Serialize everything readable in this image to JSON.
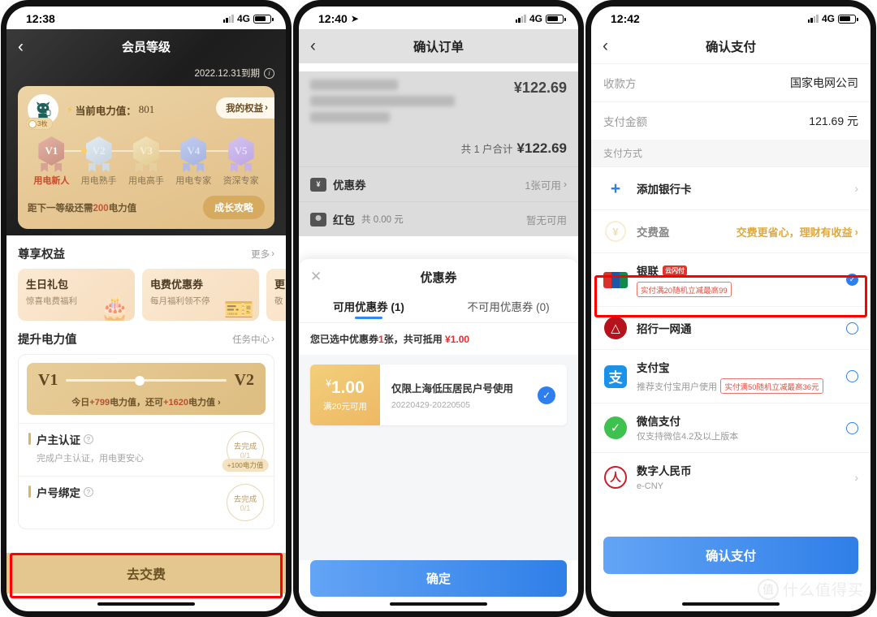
{
  "phone1": {
    "status": {
      "time": "12:38",
      "network": "4G"
    },
    "nav": {
      "title": "会员等级",
      "back_icon": "chevron-left-icon"
    },
    "expiry": "2022.12.31到期",
    "card": {
      "coin_badge": "3枚",
      "power_label": "当前电力值：",
      "power_value": "801",
      "rights_button": "我的权益",
      "levels": [
        {
          "code": "V1",
          "name": "用电新人"
        },
        {
          "code": "V2",
          "name": "用电熟手"
        },
        {
          "code": "V3",
          "name": "用电高手"
        },
        {
          "code": "V4",
          "name": "用电专家"
        },
        {
          "code": "V5",
          "name": "资深专家"
        }
      ],
      "need_prefix": "距下一等级还需",
      "need_value": "200",
      "need_suffix": "电力值",
      "grow_button": "成长攻略"
    },
    "benefits_section": {
      "title": "尊享权益",
      "more": "更多",
      "cards": [
        {
          "title": "生日礼包",
          "desc": "惊喜电费福利",
          "icon": "cake-icon"
        },
        {
          "title": "电费优惠券",
          "desc": "每月福利领不停",
          "icon": "ticket-icon"
        },
        {
          "title": "更",
          "desc": "敬",
          "icon": "more-icon"
        }
      ]
    },
    "boost_section": {
      "title": "提升电力值",
      "more": "任务中心",
      "slider": {
        "from": "V1",
        "to": "V2",
        "today_prefix": "今日",
        "today_value": "+799",
        "today_mid": "电力值，还可",
        "more_value": "+1620",
        "more_suffix": "电力值"
      },
      "tasks": [
        {
          "title": "户主认证",
          "desc": "完成户主认证，用电更安心",
          "action": "去完成",
          "progress": "0/1",
          "reward": "+100电力值"
        },
        {
          "title": "户号绑定",
          "desc": "",
          "action": "去完成",
          "progress": "0/1",
          "reward": ""
        }
      ]
    },
    "bottom_button": "去交费"
  },
  "phone2": {
    "status": {
      "time": "12:40",
      "network": "4G"
    },
    "nav": {
      "title": "确认订单",
      "back_icon": "chevron-left-icon"
    },
    "order": {
      "amount": "¥122.69",
      "total_label": "共 1 户合计",
      "total_amount": "¥122.69"
    },
    "rows": [
      {
        "name": "优惠券",
        "icon": "coupon-icon",
        "value": "1张可用",
        "chevron": true,
        "note": ""
      },
      {
        "name": "红包",
        "icon": "redpacket-icon",
        "value": "暂无可用",
        "chevron": false,
        "note": "共 0.00 元"
      }
    ],
    "sheet": {
      "title": "优惠券",
      "close_icon": "close-icon",
      "tabs": [
        {
          "label": "可用优惠券 (1)",
          "active": true
        },
        {
          "label": "不可用优惠券 (0)",
          "active": false
        }
      ],
      "selection_note": {
        "prefix": "您已选中优惠券",
        "count": "1",
        "mid": "张，共可抵用 ",
        "amount": "¥1.00"
      },
      "coupon": {
        "amount": "1.00",
        "currency": "¥",
        "condition": "满20元可用",
        "name": "仅限上海低压居民户号使用",
        "date": "20220429-20220505",
        "selected": true
      },
      "confirm_button": "确定"
    }
  },
  "phone3": {
    "status": {
      "time": "12:42",
      "network": "4G"
    },
    "nav": {
      "title": "确认支付",
      "back_icon": "chevron-left-icon"
    },
    "payee": {
      "label": "收款方",
      "value": "国家电网公司"
    },
    "amount": {
      "label": "支付金额",
      "value": "121.69 元"
    },
    "methods_label": "支付方式",
    "add_card": {
      "label": "添加银行卡",
      "icon": "plus-icon"
    },
    "jiaofeiying": {
      "label": "交费盈",
      "link": "交费更省心，理财有收益",
      "icon": "yen-coin-icon"
    },
    "methods": [
      {
        "name": "银联",
        "icon": "unionpay-icon",
        "sub": "",
        "badge": "实付满20随机立减最高99",
        "tag": "云闪付",
        "selected": true,
        "highlighted": true,
        "control": "radio"
      },
      {
        "name": "招行一网通",
        "icon": "cmb-icon",
        "sub": "",
        "badge": "",
        "tag": "",
        "selected": false,
        "highlighted": false,
        "control": "radio"
      },
      {
        "name": "支付宝",
        "icon": "alipay-icon",
        "sub": "推荐支付宝用户使用",
        "badge": "实付满50随机立减最高36元",
        "tag": "",
        "selected": false,
        "highlighted": false,
        "control": "radio"
      },
      {
        "name": "微信支付",
        "icon": "wechat-pay-icon",
        "sub": "仅支持微信4.2及以上版本",
        "badge": "",
        "tag": "",
        "selected": false,
        "highlighted": false,
        "control": "radio"
      },
      {
        "name": "数字人民币",
        "icon": "ecny-icon",
        "sub": "e-CNY",
        "badge": "",
        "tag": "",
        "selected": false,
        "highlighted": false,
        "control": "chevron"
      }
    ],
    "pay_button": "确认支付"
  },
  "watermark": {
    "text": "什么值得买",
    "mark": "值"
  },
  "colors": {
    "gold": "#e3c78f",
    "blue": "#2d7ff0",
    "red_highlight": "#ff0000",
    "dark_header": "#1d1d1d"
  }
}
